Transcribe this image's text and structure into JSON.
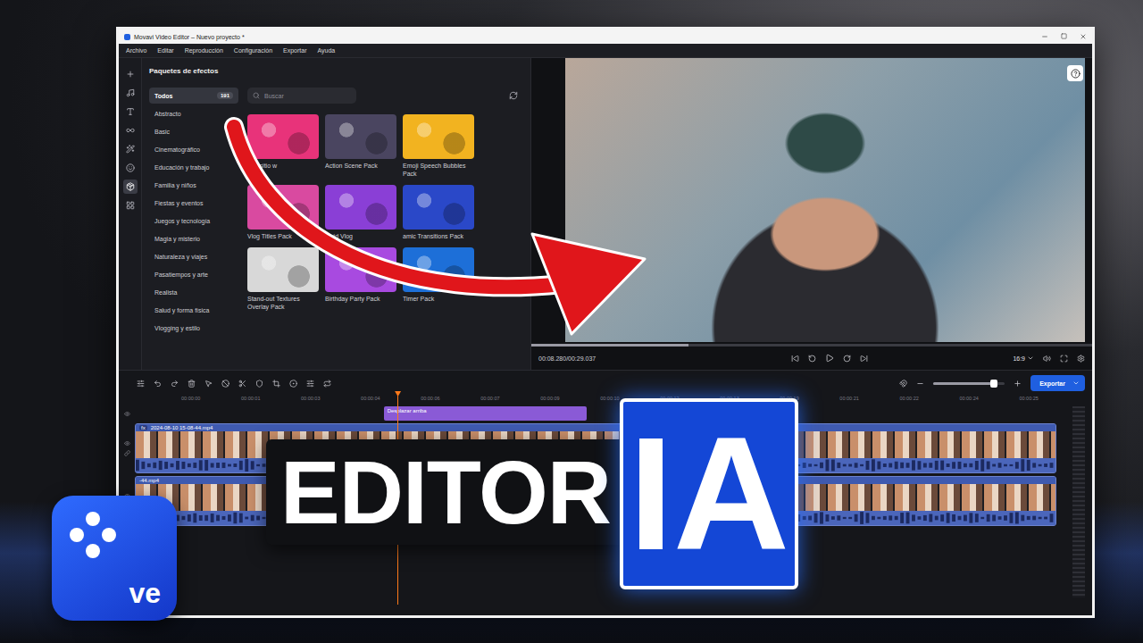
{
  "window": {
    "title": "Movavi Video Editor – Nuevo proyecto *"
  },
  "menu": [
    "Archivo",
    "Editar",
    "Reproducción",
    "Configuración",
    "Exportar",
    "Ayuda"
  ],
  "tool_rail": [
    {
      "selected": false
    },
    {
      "selected": false
    },
    {
      "selected": false
    },
    {
      "selected": false
    },
    {
      "selected": false
    },
    {
      "selected": false
    },
    {
      "selected": true
    },
    {
      "selected": false
    }
  ],
  "effects_panel": {
    "title": "Paquetes de efectos",
    "search": {
      "placeholder": "Buscar"
    },
    "categories": [
      {
        "label": "Todos",
        "count": "191",
        "selected": true
      },
      {
        "label": "Abstracto",
        "selected": false
      },
      {
        "label": "Basic",
        "selected": false
      },
      {
        "label": "Cinematográfico",
        "selected": false
      },
      {
        "label": "Educación y trabajo",
        "selected": false
      },
      {
        "label": "Familia y niños",
        "selected": false
      },
      {
        "label": "Fiestas y eventos",
        "selected": false
      },
      {
        "label": "Juegos y tecnología",
        "selected": false
      },
      {
        "label": "Magia y misterio",
        "selected": false
      },
      {
        "label": "Naturaleza y viajes",
        "selected": false
      },
      {
        "label": "Pasatiempos y arte",
        "selected": false
      },
      {
        "label": "Realista",
        "selected": false
      },
      {
        "label": "Salud y forma física",
        "selected": false
      },
      {
        "label": "Vlogging y estilo",
        "selected": false
      }
    ],
    "packs": [
      {
        "label": "Ir al sitio w",
        "color": "#e8337a"
      },
      {
        "label": "Action Scene Pack",
        "color": "#4a4560"
      },
      {
        "label": "Emoji Speech Bubbles Pack",
        "color": "#f2b320"
      },
      {
        "label": "Vlog Titles Pack",
        "color": "#d94aa0"
      },
      {
        "label": "Vivid Vlog",
        "color": "#8a3fd6"
      },
      {
        "label": "amic Transitions Pack",
        "color": "#2a48c8"
      },
      {
        "label": "Stand-out Textures Overlay Pack",
        "color": "#d8d8d8"
      },
      {
        "label": "Birthday Party Pack",
        "color": "#a84ae0"
      },
      {
        "label": "Timer Pack",
        "color": "#1d6fd8"
      }
    ]
  },
  "preview": {
    "time": "00:08.280/00:29.037",
    "aspect": "16:9",
    "level": 0.28
  },
  "timeline": {
    "export": "Exportar",
    "zoom": 0.85,
    "ruler": [
      "00:00:00",
      "00:00:01",
      "00:00:03",
      "00:00:04",
      "00:00:06",
      "00:00:07",
      "00:00:09",
      "00:00:10",
      "00:00:12",
      "00:00:13",
      "00:00:19",
      "00:00:21",
      "00:00:22",
      "00:00:24",
      "00:00:25"
    ],
    "playhead": 0.285,
    "transition": "Desplazar arriba",
    "clips": [
      {
        "name": "2024-08-10 15-08-44.mp4",
        "badge": "fx"
      },
      {
        "name": "-44.mp4"
      }
    ],
    "duration": "00:00:29"
  },
  "overlay": {
    "headline": "EDITOR",
    "badge": "IA",
    "logo": "ve"
  }
}
